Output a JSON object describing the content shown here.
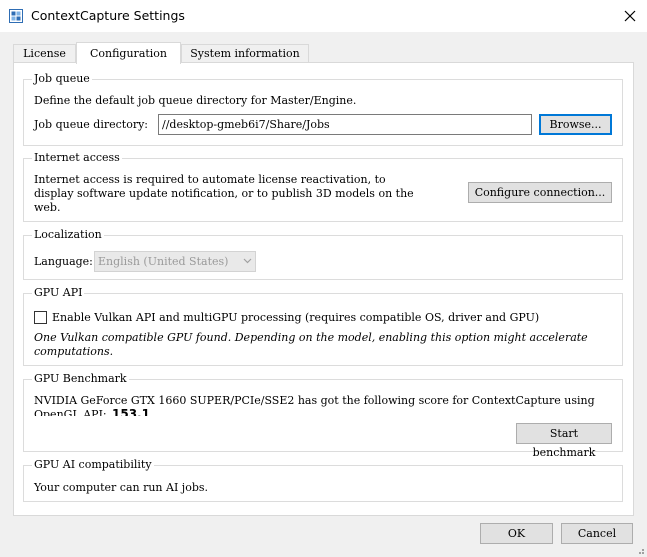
{
  "window": {
    "title": "ContextCapture Settings"
  },
  "tabs": [
    {
      "label": "License"
    },
    {
      "label": "Configuration"
    },
    {
      "label": "System information"
    }
  ],
  "job_queue": {
    "title": "Job queue",
    "description": "Define the default job queue directory for Master/Engine.",
    "dir_label": "Job queue directory:",
    "dir_value": "//desktop-gmeb6i7/Share/Jobs",
    "browse_label": "Browse..."
  },
  "internet": {
    "title": "Internet access",
    "line1": "Internet access is required to automate license reactivation, to",
    "line2": "display software update notification, or to publish 3D models on the",
    "line3": "web.",
    "configure_label": "Configure connection..."
  },
  "localization": {
    "title": "Localization",
    "language_label": "Language:",
    "language_value": "English (United States)"
  },
  "gpu_api": {
    "title": "GPU API",
    "checkbox_label": "Enable Vulkan API and multiGPU processing (requires compatible OS, driver and GPU)",
    "checked": false,
    "note_line1": "One Vulkan compatible GPU found. Depending on the model, enabling this option might accelerate",
    "note_line2": "computations."
  },
  "gpu_benchmark": {
    "title": "GPU Benchmark",
    "line1": "NVIDIA GeForce GTX 1660 SUPER/PCIe/SSE2 has got the following score for ContextCapture using",
    "line2_prefix": "OpenGL API:",
    "score": "153.1",
    "start_label": "Start benchmark"
  },
  "gpu_ai": {
    "title": "GPU AI compatibility",
    "text": "Your computer can run AI jobs."
  },
  "footer": {
    "ok_label": "OK",
    "cancel_label": "Cancel"
  },
  "colors": {
    "accent": "#0078d7",
    "app_icon": "#2e6db4"
  },
  "icons": [
    "app-icon",
    "close-icon",
    "chevron-down-icon",
    "size-grip-icon"
  ]
}
